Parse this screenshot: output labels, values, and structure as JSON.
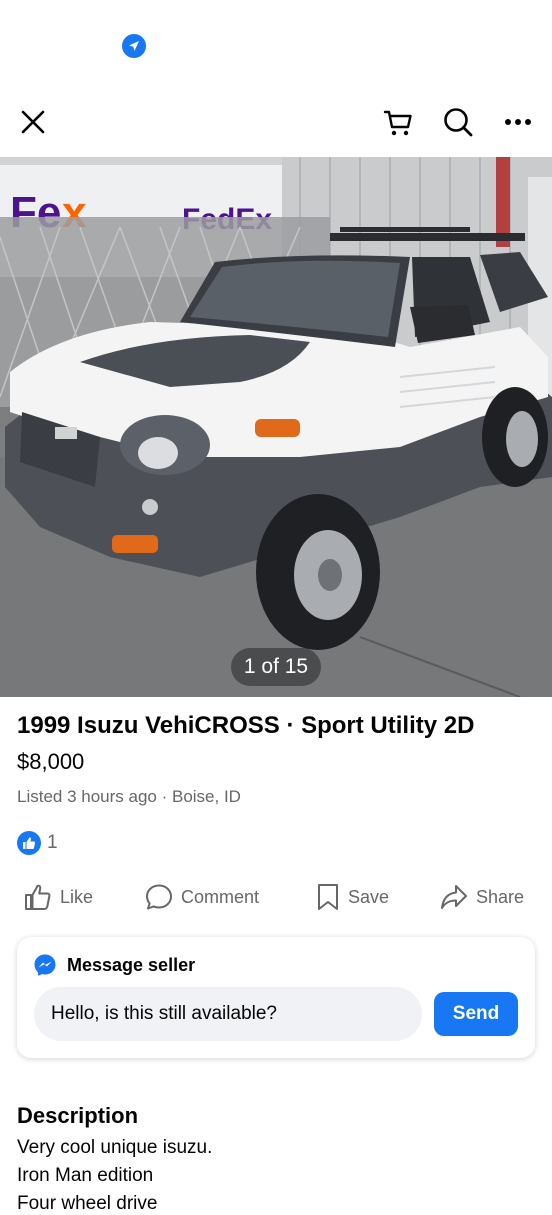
{
  "status_bar": {
    "location_icon": "location-arrow-icon"
  },
  "nav": {
    "close_icon": "close-icon",
    "cart_icon": "cart-icon",
    "search_icon": "search-icon",
    "more_icon": "more-icon"
  },
  "photo": {
    "counter": "1 of 15",
    "subject": "white and gray 1999 Isuzu VehiCROSS parked in front of a FedEx truck"
  },
  "listing": {
    "title": "1999 Isuzu VehiCROSS · Sport Utility 2D",
    "price": "$8,000",
    "meta": "Listed 3 hours ago · Boise, ID",
    "reaction_count": "1"
  },
  "actions": {
    "like": "Like",
    "comment": "Comment",
    "save": "Save",
    "share": "Share"
  },
  "message": {
    "heading": "Message seller",
    "input_value": "Hello, is this still available?",
    "send_label": "Send"
  },
  "description": {
    "heading": "Description",
    "lines": [
      "Very cool unique isuzu.",
      "Iron Man edition",
      "Four wheel drive"
    ]
  },
  "colors": {
    "accent": "#1877f2",
    "secondary_text": "#65676b",
    "input_bg": "#f0f2f5"
  }
}
